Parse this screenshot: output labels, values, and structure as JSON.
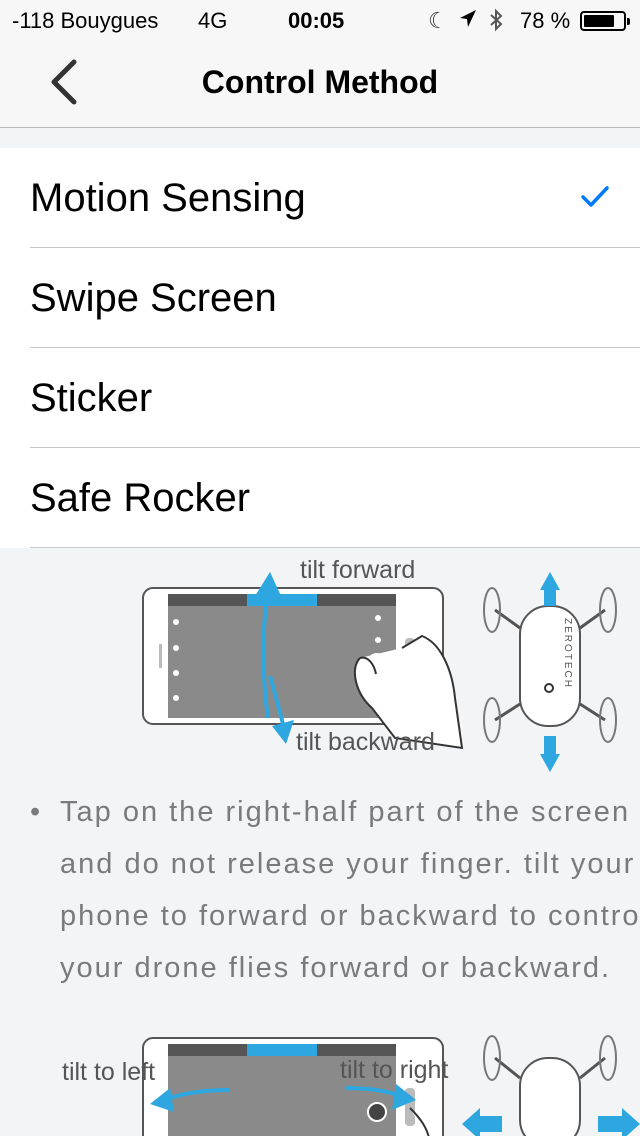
{
  "status_bar": {
    "carrier": "-118 Bouygues",
    "network": "4G",
    "time": "00:05",
    "battery_percent_text": "78 %",
    "battery_level": 0.78
  },
  "nav": {
    "title": "Control Method"
  },
  "options": [
    {
      "label": "Motion Sensing",
      "selected": true
    },
    {
      "label": "Swipe Screen",
      "selected": false
    },
    {
      "label": "Sticker",
      "selected": false
    },
    {
      "label": "Safe Rocker",
      "selected": false
    }
  ],
  "illustration": {
    "tilt_forward": "tilt forward",
    "tilt_backward": "tilt backward",
    "tilt_left": "tilt to left",
    "tilt_right": "tilt to right",
    "brand_text": "ZEROTECH"
  },
  "instruction": {
    "bullet": "•",
    "lines": [
      "Tap on the right-half part of the screen",
      "and do not release your finger. tilt your",
      "phone to forward or backward  to control",
      " your drone flies forward or backward."
    ]
  },
  "colors": {
    "accent": "#007aff",
    "arrow_blue": "#2ea7e0"
  }
}
